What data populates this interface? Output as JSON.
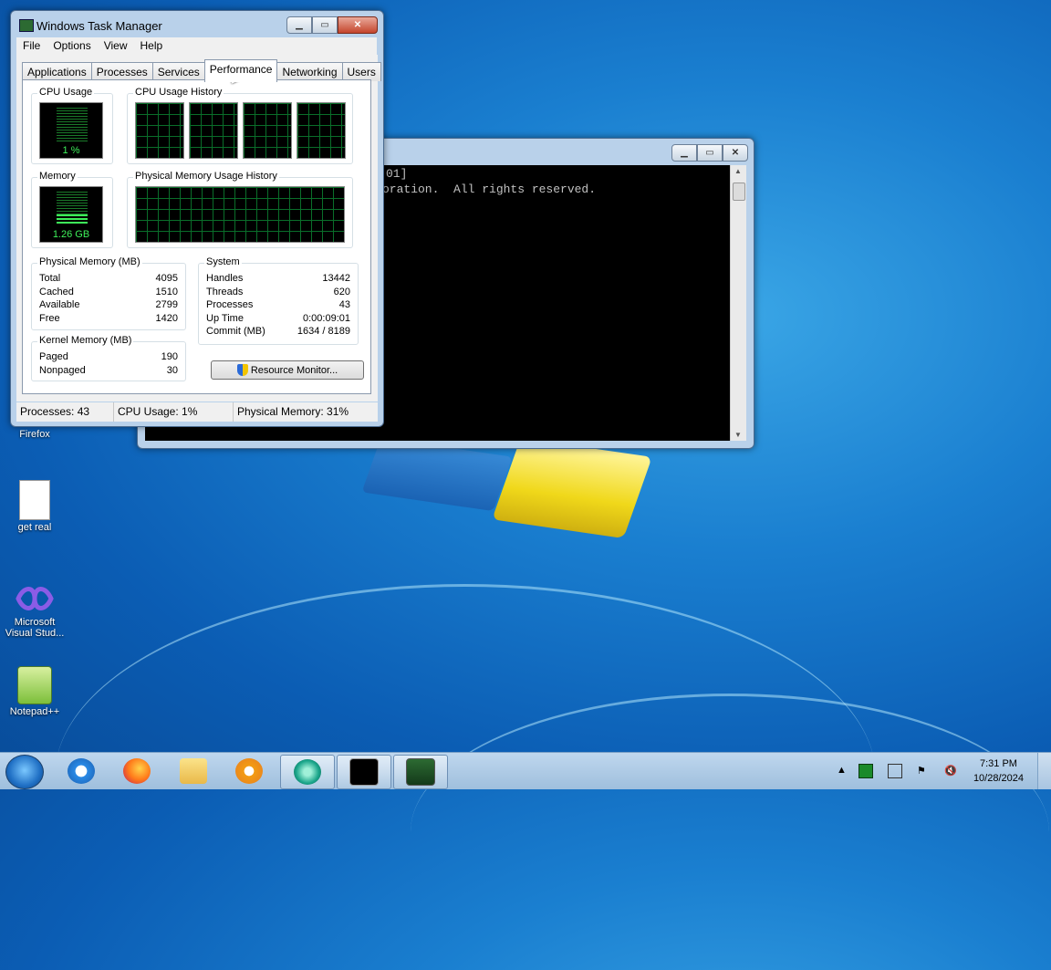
{
  "desktop": {
    "icons": [
      {
        "label": "Firefox"
      },
      {
        "label": "get real"
      },
      {
        "label": "Microsoft Visual Stud..."
      },
      {
        "label": "Notepad++"
      }
    ]
  },
  "task_manager": {
    "title": "Windows Task Manager",
    "menu": [
      "File",
      "Options",
      "View",
      "Help"
    ],
    "tabs": [
      "Applications",
      "Processes",
      "Services",
      "Performance",
      "Networking",
      "Users"
    ],
    "active_tab": "Performance",
    "cpu_usage": {
      "label": "CPU Usage",
      "value": "1 %"
    },
    "cpu_history": {
      "label": "CPU Usage History"
    },
    "memory": {
      "label": "Memory",
      "value": "1.26 GB"
    },
    "memory_history": {
      "label": "Physical Memory Usage History"
    },
    "physical_memory": {
      "label": "Physical Memory (MB)",
      "rows": [
        {
          "name": "Total",
          "value": "4095"
        },
        {
          "name": "Cached",
          "value": "1510"
        },
        {
          "name": "Available",
          "value": "2799"
        },
        {
          "name": "Free",
          "value": "1420"
        }
      ]
    },
    "kernel_memory": {
      "label": "Kernel Memory (MB)",
      "rows": [
        {
          "name": "Paged",
          "value": "190"
        },
        {
          "name": "Nonpaged",
          "value": "30"
        }
      ]
    },
    "system": {
      "label": "System",
      "rows": [
        {
          "name": "Handles",
          "value": "13442"
        },
        {
          "name": "Threads",
          "value": "620"
        },
        {
          "name": "Processes",
          "value": "43"
        },
        {
          "name": "Up Time",
          "value": "0:00:09:01"
        },
        {
          "name": "Commit (MB)",
          "value": "1634 / 8189"
        }
      ]
    },
    "resource_monitor_label": "Resource Monitor...",
    "status": {
      "processes": "Processes: 43",
      "cpu": "CPU Usage: 1%",
      "memory": "Physical Memory: 31%"
    }
  },
  "cmd": {
    "line1": "01]",
    "line2": "oration.  All rights reserved."
  },
  "taskbar": {
    "time": "7:31 PM",
    "date": "10/28/2024"
  },
  "colors": {
    "graph_green": "#3ef05a",
    "title_bar": "#b9d1ea",
    "desktop_blue": "#1a7fd0"
  }
}
